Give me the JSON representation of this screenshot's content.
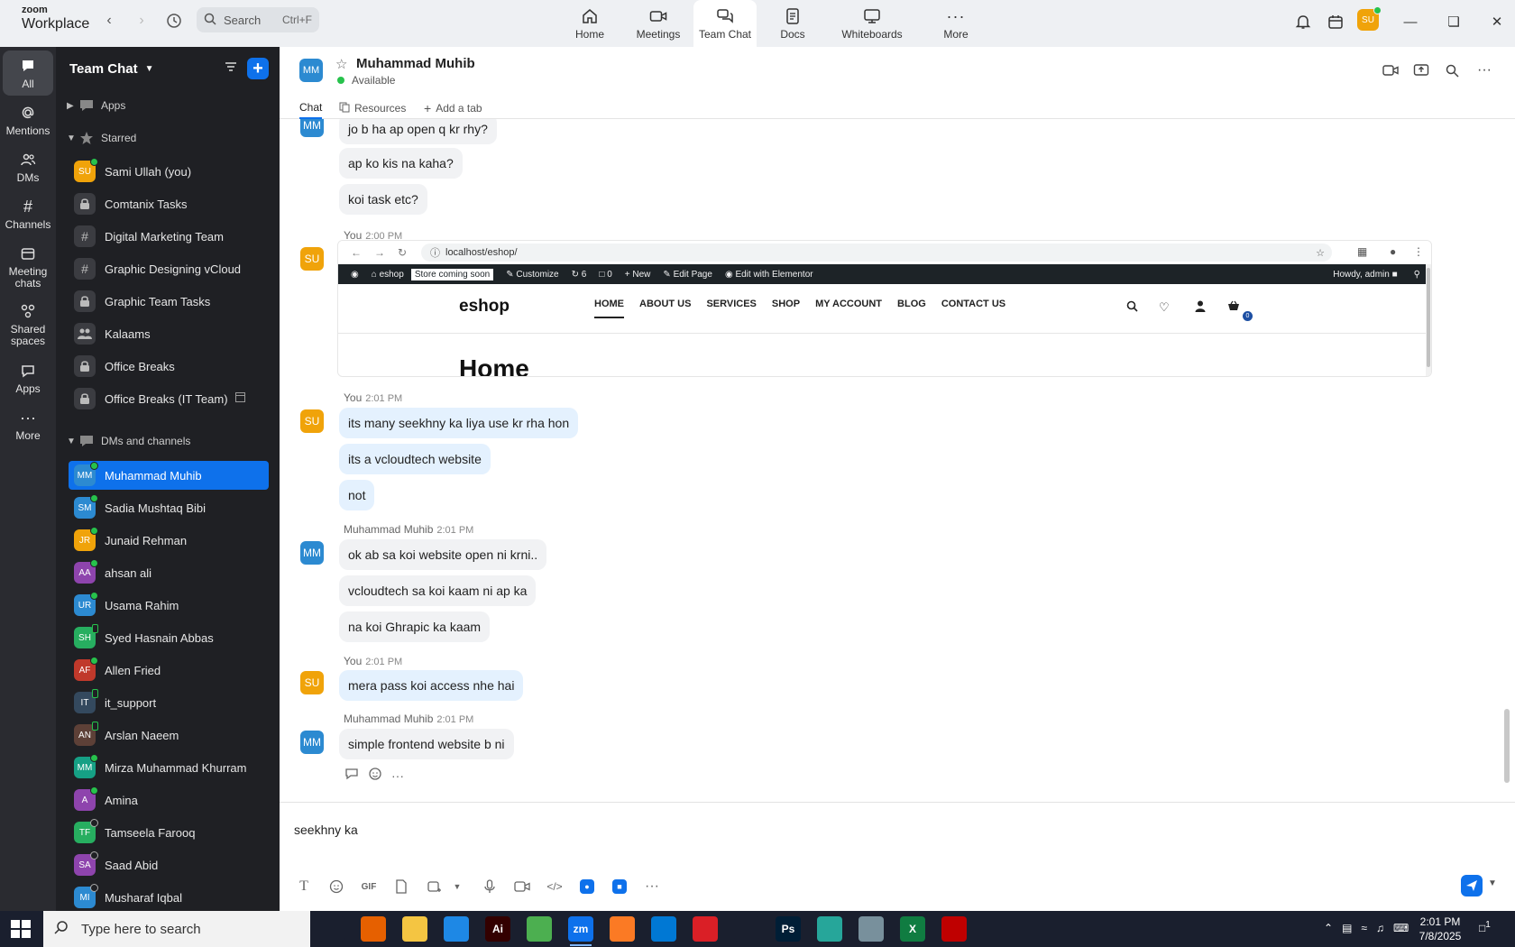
{
  "brand": {
    "line1": "zoom",
    "line2": "Workplace"
  },
  "search": {
    "placeholder": "Search",
    "shortcut": "Ctrl+F"
  },
  "top_nav": [
    {
      "label": "Home",
      "icon": "home-icon"
    },
    {
      "label": "Meetings",
      "icon": "video-icon"
    },
    {
      "label": "Team Chat",
      "icon": "chat-icon",
      "active": true
    },
    {
      "label": "Docs",
      "icon": "docs-icon"
    },
    {
      "label": "Whiteboards",
      "icon": "whiteboard-icon"
    },
    {
      "label": "More",
      "icon": "more-icon"
    }
  ],
  "me": {
    "initials": "SU",
    "color": "#f0a30a"
  },
  "rail": [
    {
      "label": "All",
      "icon": "chat-bubble-icon",
      "active": true
    },
    {
      "label": "Mentions",
      "icon": "at-icon"
    },
    {
      "label": "DMs",
      "icon": "people-icon"
    },
    {
      "label": "Channels",
      "icon": "hash-icon"
    },
    {
      "label": "Meeting chats",
      "icon": "calendar-icon"
    },
    {
      "label": "Shared spaces",
      "icon": "shared-icon"
    },
    {
      "label": "Apps",
      "icon": "apps-icon"
    },
    {
      "label": "More",
      "icon": "more-icon"
    }
  ],
  "sidebar": {
    "title": "Team Chat",
    "apps_label": "Apps",
    "starred_label": "Starred",
    "dms_label": "DMs and channels",
    "starred": [
      {
        "label": "Sami Ullah (you)",
        "kind": "avatar",
        "initials": "SU",
        "color": "#f0a30a",
        "status": "on"
      },
      {
        "label": "Comtanix Tasks",
        "kind": "lock"
      },
      {
        "label": "Digital Marketing Team",
        "kind": "hash"
      },
      {
        "label": "Graphic Designing vCloud",
        "kind": "hash"
      },
      {
        "label": "Graphic Team Tasks",
        "kind": "lock"
      },
      {
        "label": "Kalaams",
        "kind": "group"
      },
      {
        "label": "Office Breaks",
        "kind": "lock"
      },
      {
        "label": "Office Breaks (IT Team)",
        "kind": "lock",
        "extra": true
      }
    ],
    "dms": [
      {
        "label": "Muhammad Muhib",
        "initials": "MM",
        "color": "#2c8ad1",
        "status": "on",
        "active": true
      },
      {
        "label": "Sadia Mushtaq Bibi",
        "initials": "SM",
        "color": "#2c8ad1",
        "status": "on"
      },
      {
        "label": "Junaid Rehman",
        "initials": "JR",
        "color": "#f0a30a",
        "status": "on"
      },
      {
        "label": "ahsan ali",
        "initials": "AA",
        "color": "#8e44ad",
        "status": "on"
      },
      {
        "label": "Usama Rahim",
        "initials": "UR",
        "color": "#2c8ad1",
        "status": "on"
      },
      {
        "label": "Syed Hasnain Abbas",
        "initials": "SH",
        "color": "#27ae60",
        "status": "mob"
      },
      {
        "label": "Allen Fried",
        "initials": "AF",
        "color": "#c0392b",
        "status": "on"
      },
      {
        "label": "it_support",
        "initials": "IT",
        "color": "#34495e",
        "status": "mob"
      },
      {
        "label": "Arslan Naeem",
        "initials": "AN",
        "color": "#5d4037",
        "status": "mob"
      },
      {
        "label": "Mirza Muhammad Khurram",
        "initials": "MM",
        "color": "#16a085",
        "status": "on"
      },
      {
        "label": "Amina",
        "initials": "A",
        "color": "#8e44ad",
        "status": "on"
      },
      {
        "label": "Tamseela Farooq",
        "initials": "TF",
        "color": "#27ae60",
        "status": "off"
      },
      {
        "label": "Saad Abid",
        "initials": "SA",
        "color": "#8e44ad",
        "status": "off"
      },
      {
        "label": "Musharaf Iqbal",
        "initials": "MI",
        "color": "#2c8ad1",
        "status": "off"
      }
    ]
  },
  "chat": {
    "contact_name": "Muhammad Muhib",
    "contact_initials": "MM",
    "status": "Available",
    "tabs": {
      "chat": "Chat",
      "resources": "Resources",
      "add": "Add a tab"
    },
    "messages": {
      "m1": "jo b ha ap open q kr rhy?",
      "m2": "ap ko kis na kaha?",
      "m3": "koi task etc?",
      "you": "You",
      "t1": "2:00 PM",
      "t2": "2:01 PM",
      "them_name": "Muhammad Muhib",
      "y1": "its many seekhny ka liya use kr rha hon",
      "y2": "its a vcloudtech website",
      "y3": "not",
      "h1": "ok ab sa koi website open ni krni..",
      "h2": "vcloudtech sa koi kaam ni ap ka",
      "h3": "na koi Ghrapic ka kaam",
      "y4": "mera pass koi access nhe hai",
      "h4": "simple frontend website b ni"
    },
    "shot": {
      "url": "localhost/eshop/",
      "wp_site": "eshop",
      "coming": "Store coming soon",
      "customize": "Customize",
      "updates": "6",
      "comments": "0",
      "new": "New",
      "edit_page": "Edit Page",
      "elementor": "Edit with Elementor",
      "howdy": "Howdy, admin",
      "logo": "eshop",
      "menu": [
        "HOME",
        "ABOUT US",
        "SERVICES",
        "SHOP",
        "MY ACCOUNT",
        "BLOG",
        "CONTACT US"
      ],
      "cart_count": "0",
      "heading": "Home"
    },
    "draft": "seekhny ka "
  },
  "taskbar": {
    "search_placeholder": "Type here to search",
    "apps": [
      {
        "name": "task-view",
        "label": "",
        "color": "#1a1f2e"
      },
      {
        "name": "firefox",
        "label": "",
        "color": "#e66000"
      },
      {
        "name": "file-explorer",
        "label": "",
        "color": "#f4c542"
      },
      {
        "name": "vscode",
        "label": "",
        "color": "#1e88e5"
      },
      {
        "name": "illustrator",
        "label": "Ai",
        "color": "#330000"
      },
      {
        "name": "chrome",
        "label": "",
        "color": "#4caf50"
      },
      {
        "name": "zoom",
        "label": "zm",
        "color": "#0e71eb",
        "active": true
      },
      {
        "name": "xampp",
        "label": "",
        "color": "#fb7a24"
      },
      {
        "name": "outlook",
        "label": "",
        "color": "#0078d4"
      },
      {
        "name": "creative-cloud",
        "label": "",
        "color": "#da1f26"
      },
      {
        "name": "pen-tool",
        "label": "",
        "color": "#1a1f2e"
      },
      {
        "name": "photoshop",
        "label": "Ps",
        "color": "#001e36"
      },
      {
        "name": "app-diamond",
        "label": "",
        "color": "#26a69a"
      },
      {
        "name": "app-notes",
        "label": "",
        "color": "#78909c"
      },
      {
        "name": "excel",
        "label": "X",
        "color": "#107c41"
      },
      {
        "name": "filezilla",
        "label": "",
        "color": "#bf0000"
      }
    ],
    "time": "2:01 PM",
    "date": "7/8/2025",
    "notif_count": "1"
  }
}
